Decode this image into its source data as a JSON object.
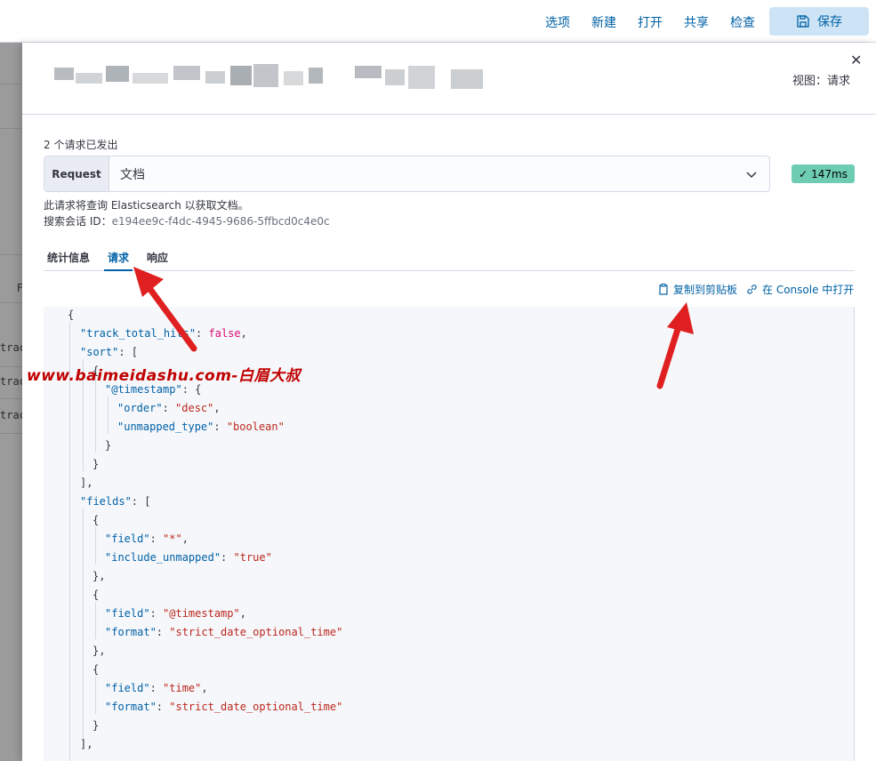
{
  "toolbar": {
    "options": "选项",
    "new": "新建",
    "open": "打开",
    "share": "共享",
    "inspect": "检查",
    "save": "保存"
  },
  "background": {
    "letter": "F",
    "rows": [
      "trac",
      "trac",
      "trac"
    ]
  },
  "flyout": {
    "view_label": "视图：请求",
    "requests_sent": "2 个请求已发出",
    "request_prepend": "Request",
    "request_value": "文档",
    "duration": "147ms",
    "desc_line1": "此请求将查询 Elasticsearch 以获取文档。",
    "session_label": "搜索会话 ID：",
    "session_id": "e194ee9c-f4dc-4945-9686-5ffbcd0c4e0c",
    "tabs": {
      "stats": "统计信息",
      "request": "请求",
      "response": "响应"
    },
    "copy_label": "复制到剪贴板",
    "console_label": "在 Console 中打开"
  },
  "watermark": "www.baimeidashu.com-白眉大叔",
  "code": {
    "l1": "{",
    "l2_key": "\"track_total_hits\"",
    "l2_val": "false",
    "l3_key": "\"sort\"",
    "l4": "{",
    "l5_key": "\"@timestamp\"",
    "l6_key": "\"order\"",
    "l6_val": "\"desc\"",
    "l7_key": "\"unmapped_type\"",
    "l7_val": "\"boolean\"",
    "l8": "}",
    "l9": "}",
    "l10": "],",
    "l11_key": "\"fields\"",
    "l12": "{",
    "l13_key": "\"field\"",
    "l13_val": "\"*\"",
    "l14_key": "\"include_unmapped\"",
    "l14_val": "\"true\"",
    "l15": "},",
    "l16": "{",
    "l17_key": "\"field\"",
    "l17_val": "\"@timestamp\"",
    "l18_key": "\"format\"",
    "l18_val": "\"strict_date_optional_time\"",
    "l19": "},",
    "l20": "{",
    "l21_key": "\"field\"",
    "l21_val": "\"time\"",
    "l22_key": "\"format\"",
    "l22_val": "\"strict_date_optional_time\"",
    "l23": "}",
    "l24": "],"
  }
}
